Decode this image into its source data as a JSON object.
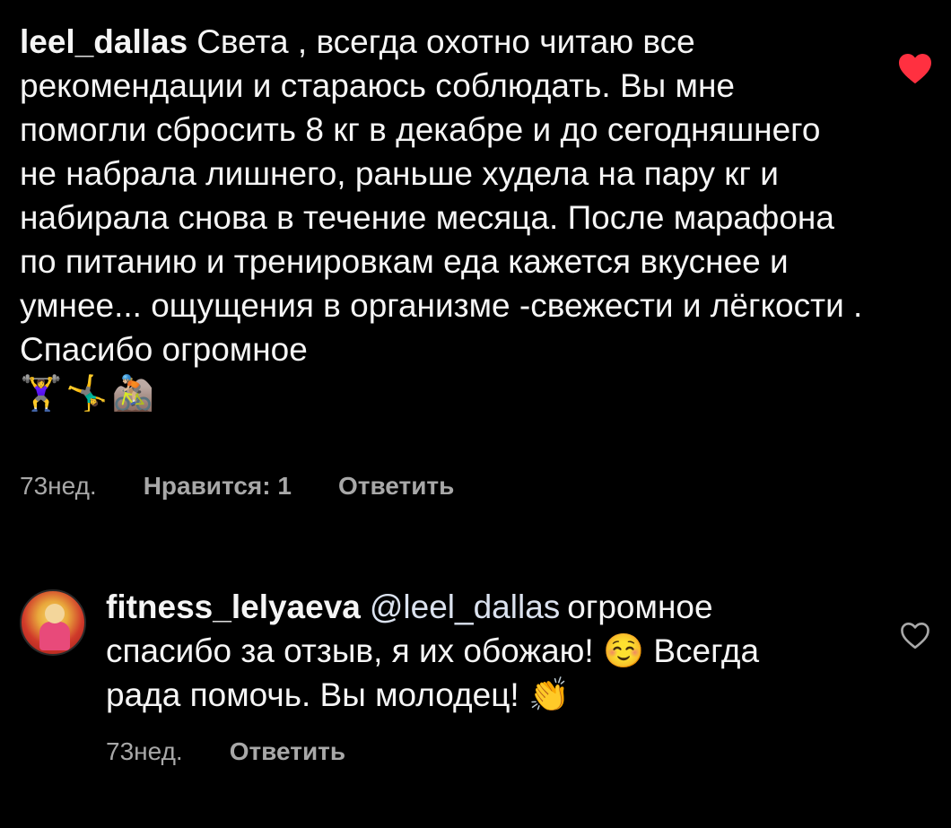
{
  "comments": [
    {
      "username": "leel_dallas",
      "text": "Света , всегда охотно читаю все рекомендации и стараюсь соблюдать. Вы мне помогли сбросить 8 кг в декабре и до сегодняшнего не набрала лишнего, раньше худела на пару кг и набирала снова в течение месяца. После марафона по питанию и тренировкам еда кажется вкуснее и умнее... ощущения в организме -свежести и лёгкости . Спасибо огромное",
      "emojis": "🏋‍♀️🤸‍♂️🚵🏼",
      "time": "73нед.",
      "likes": "Нравится: 1",
      "reply": "Ответить",
      "liked": true,
      "heart_icon": "heart-filled-icon",
      "heart_color": "#ff3040"
    },
    {
      "username": "fitness_lelyaeva",
      "mention": "@leel_dallas",
      "text": "огромное спасибо за отзыв, я их обожаю! ☺️ Всегда рада помочь. Вы молодец! 👏",
      "time": "73нед.",
      "reply": "Ответить",
      "liked": false,
      "heart_icon": "heart-outline-icon",
      "avatar_icon": "avatar-icon"
    }
  ],
  "colors": {
    "background": "#000000",
    "text": "#f5f5f5",
    "meta": "#a8a8a8",
    "like": "#ff3040"
  }
}
